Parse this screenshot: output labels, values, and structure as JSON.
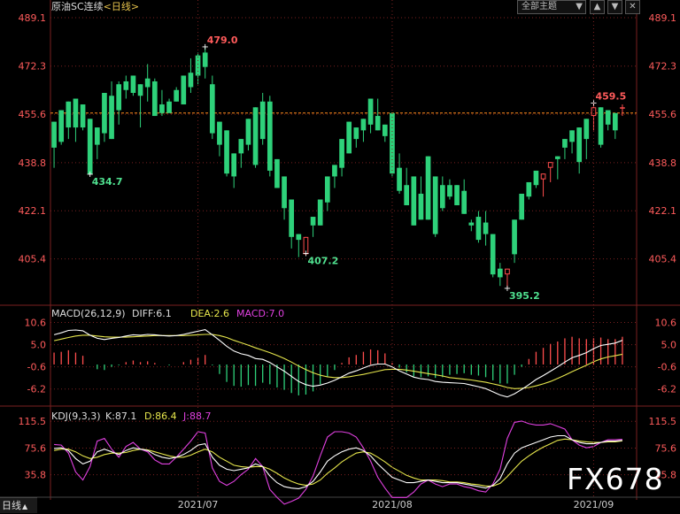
{
  "header": {
    "symbol": "原油SC连续",
    "period": "<日线>",
    "theme_label": "全部主题",
    "dropdown_icon": "triangle-down-icon"
  },
  "toolbar_icons": [
    "chevron-up-icon",
    "chevron-down-icon",
    "close-icon"
  ],
  "period_button": "日线",
  "watermark": "FX678",
  "colors": {
    "up": "#ff4d4d",
    "down": "#2ed17a",
    "diff": "#ffffff",
    "dea": "#e6e64c",
    "j": "#e040e0",
    "grid": "#7a2020",
    "ref": "#ff8c1a"
  },
  "chart_data": [
    {
      "type": "candlestick",
      "title": "原油SC连续<日线>",
      "yticks": [
        489.1,
        472.3,
        455.6,
        438.8,
        422.1,
        405.4
      ],
      "xticks": [
        "2021/07",
        "2021/08",
        "2021/09"
      ],
      "reference_line": 456.0,
      "annotations": [
        {
          "label": "479.0"
        },
        {
          "label": "434.7"
        },
        {
          "label": "407.2"
        },
        {
          "label": "395.2"
        },
        {
          "label": "459.5"
        }
      ],
      "candles": [
        [
          451,
          453,
          444,
          437
        ],
        [
          453,
          457,
          446,
          445
        ],
        [
          455,
          460,
          451,
          447
        ],
        [
          458,
          461,
          451,
          446
        ],
        [
          456,
          459,
          451,
          450
        ],
        [
          435,
          454,
          434.7,
          435
        ],
        [
          442,
          451,
          445,
          440
        ],
        [
          451,
          463,
          449,
          446
        ],
        [
          467,
          462,
          447,
          448
        ],
        [
          467,
          466,
          457,
          452
        ],
        [
          469,
          467,
          464,
          461
        ],
        [
          466,
          469,
          463,
          462
        ],
        [
          458,
          466,
          462,
          451
        ],
        [
          473,
          468,
          465,
          460
        ],
        [
          468,
          467,
          455,
          456
        ],
        [
          464,
          459,
          456,
          455
        ],
        [
          461,
          460,
          456,
          457
        ],
        [
          465,
          464,
          460,
          460
        ],
        [
          466,
          469,
          459,
          464
        ],
        [
          475,
          470,
          465,
          463
        ],
        [
          477,
          476,
          469,
          466
        ],
        [
          479,
          477,
          472,
          468
        ],
        [
          469,
          466,
          449,
          447
        ],
        [
          451,
          453,
          445,
          441
        ],
        [
          447,
          450,
          435,
          434
        ],
        [
          440,
          442,
          434,
          430
        ],
        [
          441,
          447,
          442,
          437
        ],
        [
          447,
          454,
          445,
          443
        ],
        [
          457,
          458,
          438,
          437
        ],
        [
          463,
          460,
          447,
          445
        ],
        [
          462,
          460,
          436,
          434
        ],
        [
          437,
          440,
          430,
          430
        ],
        [
          433,
          434,
          423,
          419
        ],
        [
          420,
          426,
          413,
          409
        ],
        [
          409,
          414,
          412,
          406
        ],
        [
          407.2,
          407,
          413,
          412
        ],
        [
          415,
          420,
          417,
          413
        ],
        [
          425,
          426,
          417,
          418
        ],
        [
          434,
          434,
          425,
          422
        ],
        [
          437,
          438,
          434,
          430
        ],
        [
          442,
          447,
          437,
          434
        ],
        [
          449,
          453,
          442,
          442
        ],
        [
          446,
          451,
          447,
          444
        ],
        [
          452,
          454,
          450,
          446
        ],
        [
          459,
          461,
          452,
          449
        ],
        [
          461,
          455,
          450,
          452
        ],
        [
          452,
          452,
          448,
          446
        ],
        [
          456,
          456,
          435,
          434
        ],
        [
          442,
          437,
          429,
          428
        ],
        [
          437,
          431,
          424,
          426
        ],
        [
          431,
          434,
          417,
          423
        ],
        [
          434,
          428,
          419,
          422
        ],
        [
          440,
          441,
          419,
          421
        ],
        [
          430,
          434,
          414,
          413
        ],
        [
          434,
          431,
          423,
          422
        ],
        [
          433,
          431,
          427,
          426
        ],
        [
          430,
          431,
          424,
          425
        ],
        [
          433,
          429,
          421,
          421
        ],
        [
          419,
          418,
          417,
          415
        ],
        [
          422,
          420,
          412,
          411
        ],
        [
          422,
          418,
          414,
          410
        ],
        [
          413,
          414,
          400,
          399
        ],
        [
          404,
          402,
          399,
          396
        ],
        [
          395.2,
          400,
          402,
          397
        ],
        [
          417,
          419,
          407,
          404
        ],
        [
          426,
          428,
          419,
          419
        ],
        [
          431,
          432,
          427,
          426
        ],
        [
          434,
          436,
          431,
          430
        ],
        [
          433,
          433,
          435,
          427
        ],
        [
          438,
          437,
          439,
          432
        ],
        [
          440,
          441,
          440,
          433
        ],
        [
          443,
          447,
          444,
          440
        ],
        [
          445,
          450,
          446,
          442
        ],
        [
          447,
          451,
          439,
          435
        ],
        [
          449,
          454,
          447,
          440
        ],
        [
          459.5,
          455,
          458,
          450
        ],
        [
          458,
          458,
          445,
          444
        ],
        [
          457,
          457,
          452,
          450
        ],
        [
          454,
          456,
          450,
          447
        ],
        [
          459,
          458,
          458,
          455
        ]
      ]
    },
    {
      "type": "bar+line",
      "title": "MACD(26,12,9)",
      "labels": {
        "name": "MACD(26,12,9)",
        "diff": "DIFF:6.1",
        "dea": "DEA:2.6",
        "macd": "MACD:7.0"
      },
      "yticks": [
        10.6,
        5.0,
        -0.6,
        -6.2
      ],
      "diff": [
        7.5,
        8,
        8.6,
        8.7,
        8.5,
        7.4,
        6.6,
        6.3,
        6.6,
        6.8,
        7.2,
        7.5,
        7.4,
        7.6,
        7.5,
        7.3,
        7.2,
        7.3,
        7.6,
        8,
        8.4,
        8.8,
        7.5,
        6.1,
        4.6,
        3.4,
        2.7,
        2.3,
        1.5,
        1.3,
        0.5,
        -0.6,
        -1.7,
        -3,
        -4.3,
        -5.1,
        -5.5,
        -5.2,
        -4.7,
        -4,
        -3.1,
        -2.2,
        -1.6,
        -0.9,
        -0.2,
        0.1,
        0.1,
        -0.6,
        -1.6,
        -2.4,
        -3.2,
        -3.6,
        -3.8,
        -4.3,
        -4.5,
        -4.6,
        -4.7,
        -4.8,
        -5.2,
        -5.6,
        -6.1,
        -6.9,
        -7.7,
        -8.2,
        -7.4,
        -6.3,
        -5.1,
        -3.8,
        -2.8,
        -1.7,
        -0.6,
        0.6,
        1.7,
        2.3,
        3,
        4,
        4.8,
        5.1,
        5.4,
        6.1
      ],
      "dea": [
        6,
        6.4,
        6.8,
        7.2,
        7.4,
        7.4,
        7.2,
        7,
        6.9,
        6.9,
        6.9,
        7,
        7.1,
        7.2,
        7.3,
        7.3,
        7.3,
        7.3,
        7.3,
        7.4,
        7.5,
        7.6,
        7.6,
        7.3,
        6.8,
        6.1,
        5.5,
        4.9,
        4.2,
        3.6,
        3,
        2.3,
        1.5,
        0.6,
        -0.4,
        -1.3,
        -2.1,
        -2.7,
        -3.1,
        -3.3,
        -3.3,
        -3.1,
        -2.8,
        -2.5,
        -2.1,
        -1.7,
        -1.3,
        -1.2,
        -1.2,
        -1.4,
        -1.7,
        -2,
        -2.3,
        -2.6,
        -2.9,
        -3.3,
        -3.5,
        -3.7,
        -3.9,
        -4.2,
        -4.5,
        -4.9,
        -5.3,
        -5.8,
        -6.1,
        -6,
        -5.8,
        -5.4,
        -4.9,
        -4.3,
        -3.5,
        -2.7,
        -1.8,
        -1,
        -0.2,
        0.7,
        1.4,
        1.9,
        2.2,
        2.6
      ],
      "macd": [
        3,
        3.2,
        3.6,
        3,
        2.2,
        0,
        -1.2,
        -1.4,
        -0.6,
        -0.2,
        0.6,
        1,
        0.6,
        0.8,
        0.4,
        0,
        -0.2,
        0,
        0.6,
        1.2,
        1.8,
        2.4,
        -0.2,
        -2.4,
        -4.4,
        -5.4,
        -5.6,
        -5.2,
        -5.4,
        -4.6,
        -5,
        -5.8,
        -6.4,
        -7.2,
        -7.8,
        -7.6,
        -6.8,
        -5,
        -3.2,
        -1.4,
        0.4,
        1.8,
        2.4,
        3.2,
        3.8,
        3.6,
        2.8,
        0.4,
        -0.8,
        -2,
        -3,
        -3.2,
        -3,
        -3.4,
        -3.2,
        -2.6,
        -2.4,
        -2.2,
        -2.6,
        -2.8,
        -3.2,
        -4,
        -4.8,
        -4.8,
        -2.6,
        -0.6,
        1.4,
        3.2,
        4.2,
        5.2,
        5.8,
        6.6,
        7,
        6.6,
        6.4,
        6.6,
        6.8,
        6.4,
        6.4,
        7
      ]
    },
    {
      "type": "line",
      "title": "KDJ(9,3,3)",
      "labels": {
        "name": "KDJ(9,3,3)",
        "k": "K:87.1",
        "d": "D:86.4",
        "j": "J:88.7"
      },
      "yticks": [
        115.5,
        75.6,
        35.8
      ],
      "k": [
        75,
        76,
        72,
        60,
        52,
        56,
        70,
        74,
        70,
        66,
        72,
        76,
        74,
        72,
        66,
        62,
        60,
        62,
        66,
        72,
        80,
        82,
        62,
        50,
        44,
        42,
        44,
        46,
        52,
        48,
        34,
        24,
        18,
        16,
        15,
        18,
        26,
        40,
        56,
        64,
        70,
        74,
        76,
        72,
        64,
        52,
        42,
        32,
        28,
        24,
        24,
        26,
        28,
        26,
        24,
        24,
        24,
        22,
        20,
        18,
        16,
        20,
        30,
        52,
        68,
        76,
        80,
        84,
        88,
        92,
        94,
        94,
        88,
        84,
        82,
        82,
        84,
        86,
        86,
        87.1
      ],
      "d": [
        72,
        74,
        74,
        70,
        64,
        60,
        62,
        66,
        68,
        68,
        69,
        72,
        74,
        73,
        70,
        67,
        64,
        62,
        62,
        65,
        70,
        74,
        70,
        62,
        56,
        50,
        48,
        47,
        48,
        48,
        44,
        38,
        31,
        26,
        22,
        20,
        22,
        28,
        38,
        46,
        55,
        62,
        68,
        70,
        68,
        62,
        55,
        47,
        41,
        35,
        31,
        28,
        28,
        28,
        27,
        25,
        25,
        24,
        22,
        21,
        19,
        19,
        23,
        33,
        45,
        56,
        64,
        71,
        77,
        82,
        87,
        89,
        88,
        86,
        85,
        84,
        84,
        85,
        85,
        86.4
      ],
      "j": [
        81,
        80,
        68,
        40,
        28,
        48,
        86,
        90,
        74,
        62,
        78,
        84,
        74,
        70,
        58,
        52,
        52,
        62,
        74,
        86,
        100,
        98,
        46,
        26,
        20,
        26,
        36,
        44,
        60,
        48,
        14,
        2,
        -8,
        -4,
        1,
        14,
        34,
        64,
        92,
        100,
        100,
        98,
        92,
        76,
        56,
        32,
        16,
        2,
        2,
        2,
        10,
        22,
        28,
        22,
        18,
        22,
        22,
        18,
        16,
        12,
        10,
        22,
        44,
        90,
        114,
        116,
        112,
        110,
        110,
        112,
        108,
        104,
        88,
        80,
        76,
        78,
        84,
        88,
        88,
        88.7
      ]
    }
  ]
}
